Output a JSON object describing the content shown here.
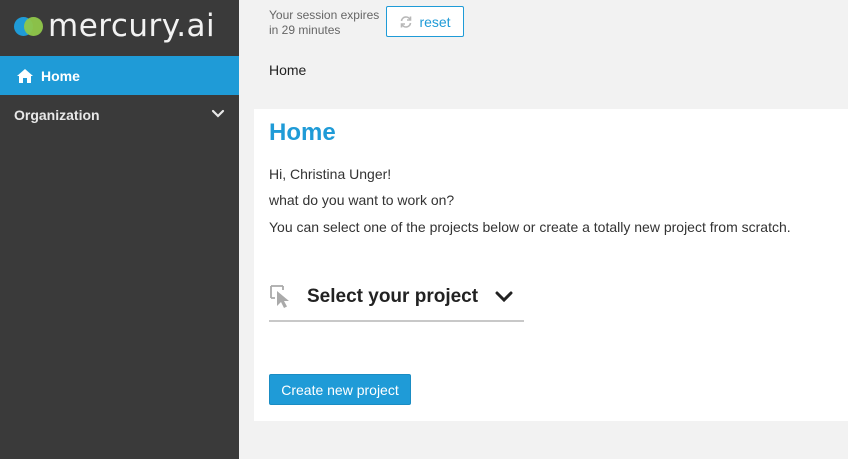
{
  "app": {
    "logo_text": "mercury.ai"
  },
  "sidebar": {
    "items": [
      {
        "label": "Home",
        "icon": "home-icon",
        "active": true
      },
      {
        "label": "Organization",
        "icon": "chevron-down-icon",
        "active": false
      }
    ]
  },
  "topbar": {
    "session_line1": "Your session expires",
    "session_line2": "in 29 minutes",
    "reset_label": "reset",
    "breadcrumb": "Home"
  },
  "main": {
    "title": "Home",
    "greeting": "Hi, Christina Unger!",
    "question": "what do you want to work on?",
    "instruction": "You can select one of the projects below or create a totally new project from scratch.",
    "select_project_label": "Select your project",
    "create_button_label": "Create new project"
  },
  "colors": {
    "accent": "#1f9bd7",
    "sidebar_bg": "#3a3a3a",
    "logo_green": "#8fc74a"
  }
}
